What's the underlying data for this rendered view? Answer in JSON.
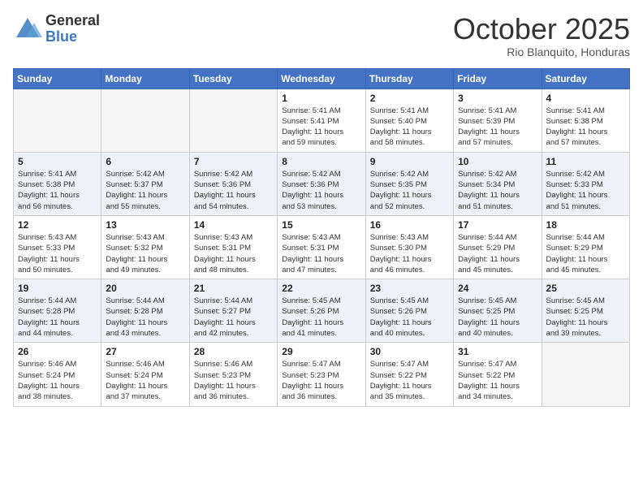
{
  "logo": {
    "general": "General",
    "blue": "Blue"
  },
  "title": "October 2025",
  "subtitle": "Rio Blanquito, Honduras",
  "headers": [
    "Sunday",
    "Monday",
    "Tuesday",
    "Wednesday",
    "Thursday",
    "Friday",
    "Saturday"
  ],
  "weeks": [
    [
      {
        "day": "",
        "info": ""
      },
      {
        "day": "",
        "info": ""
      },
      {
        "day": "",
        "info": ""
      },
      {
        "day": "1",
        "info": "Sunrise: 5:41 AM\nSunset: 5:41 PM\nDaylight: 11 hours\nand 59 minutes."
      },
      {
        "day": "2",
        "info": "Sunrise: 5:41 AM\nSunset: 5:40 PM\nDaylight: 11 hours\nand 58 minutes."
      },
      {
        "day": "3",
        "info": "Sunrise: 5:41 AM\nSunset: 5:39 PM\nDaylight: 11 hours\nand 57 minutes."
      },
      {
        "day": "4",
        "info": "Sunrise: 5:41 AM\nSunset: 5:38 PM\nDaylight: 11 hours\nand 57 minutes."
      }
    ],
    [
      {
        "day": "5",
        "info": "Sunrise: 5:41 AM\nSunset: 5:38 PM\nDaylight: 11 hours\nand 56 minutes."
      },
      {
        "day": "6",
        "info": "Sunrise: 5:42 AM\nSunset: 5:37 PM\nDaylight: 11 hours\nand 55 minutes."
      },
      {
        "day": "7",
        "info": "Sunrise: 5:42 AM\nSunset: 5:36 PM\nDaylight: 11 hours\nand 54 minutes."
      },
      {
        "day": "8",
        "info": "Sunrise: 5:42 AM\nSunset: 5:36 PM\nDaylight: 11 hours\nand 53 minutes."
      },
      {
        "day": "9",
        "info": "Sunrise: 5:42 AM\nSunset: 5:35 PM\nDaylight: 11 hours\nand 52 minutes."
      },
      {
        "day": "10",
        "info": "Sunrise: 5:42 AM\nSunset: 5:34 PM\nDaylight: 11 hours\nand 51 minutes."
      },
      {
        "day": "11",
        "info": "Sunrise: 5:42 AM\nSunset: 5:33 PM\nDaylight: 11 hours\nand 51 minutes."
      }
    ],
    [
      {
        "day": "12",
        "info": "Sunrise: 5:43 AM\nSunset: 5:33 PM\nDaylight: 11 hours\nand 50 minutes."
      },
      {
        "day": "13",
        "info": "Sunrise: 5:43 AM\nSunset: 5:32 PM\nDaylight: 11 hours\nand 49 minutes."
      },
      {
        "day": "14",
        "info": "Sunrise: 5:43 AM\nSunset: 5:31 PM\nDaylight: 11 hours\nand 48 minutes."
      },
      {
        "day": "15",
        "info": "Sunrise: 5:43 AM\nSunset: 5:31 PM\nDaylight: 11 hours\nand 47 minutes."
      },
      {
        "day": "16",
        "info": "Sunrise: 5:43 AM\nSunset: 5:30 PM\nDaylight: 11 hours\nand 46 minutes."
      },
      {
        "day": "17",
        "info": "Sunrise: 5:44 AM\nSunset: 5:29 PM\nDaylight: 11 hours\nand 45 minutes."
      },
      {
        "day": "18",
        "info": "Sunrise: 5:44 AM\nSunset: 5:29 PM\nDaylight: 11 hours\nand 45 minutes."
      }
    ],
    [
      {
        "day": "19",
        "info": "Sunrise: 5:44 AM\nSunset: 5:28 PM\nDaylight: 11 hours\nand 44 minutes."
      },
      {
        "day": "20",
        "info": "Sunrise: 5:44 AM\nSunset: 5:28 PM\nDaylight: 11 hours\nand 43 minutes."
      },
      {
        "day": "21",
        "info": "Sunrise: 5:44 AM\nSunset: 5:27 PM\nDaylight: 11 hours\nand 42 minutes."
      },
      {
        "day": "22",
        "info": "Sunrise: 5:45 AM\nSunset: 5:26 PM\nDaylight: 11 hours\nand 41 minutes."
      },
      {
        "day": "23",
        "info": "Sunrise: 5:45 AM\nSunset: 5:26 PM\nDaylight: 11 hours\nand 40 minutes."
      },
      {
        "day": "24",
        "info": "Sunrise: 5:45 AM\nSunset: 5:25 PM\nDaylight: 11 hours\nand 40 minutes."
      },
      {
        "day": "25",
        "info": "Sunrise: 5:45 AM\nSunset: 5:25 PM\nDaylight: 11 hours\nand 39 minutes."
      }
    ],
    [
      {
        "day": "26",
        "info": "Sunrise: 5:46 AM\nSunset: 5:24 PM\nDaylight: 11 hours\nand 38 minutes."
      },
      {
        "day": "27",
        "info": "Sunrise: 5:46 AM\nSunset: 5:24 PM\nDaylight: 11 hours\nand 37 minutes."
      },
      {
        "day": "28",
        "info": "Sunrise: 5:46 AM\nSunset: 5:23 PM\nDaylight: 11 hours\nand 36 minutes."
      },
      {
        "day": "29",
        "info": "Sunrise: 5:47 AM\nSunset: 5:23 PM\nDaylight: 11 hours\nand 36 minutes."
      },
      {
        "day": "30",
        "info": "Sunrise: 5:47 AM\nSunset: 5:22 PM\nDaylight: 11 hours\nand 35 minutes."
      },
      {
        "day": "31",
        "info": "Sunrise: 5:47 AM\nSunset: 5:22 PM\nDaylight: 11 hours\nand 34 minutes."
      },
      {
        "day": "",
        "info": ""
      }
    ]
  ]
}
